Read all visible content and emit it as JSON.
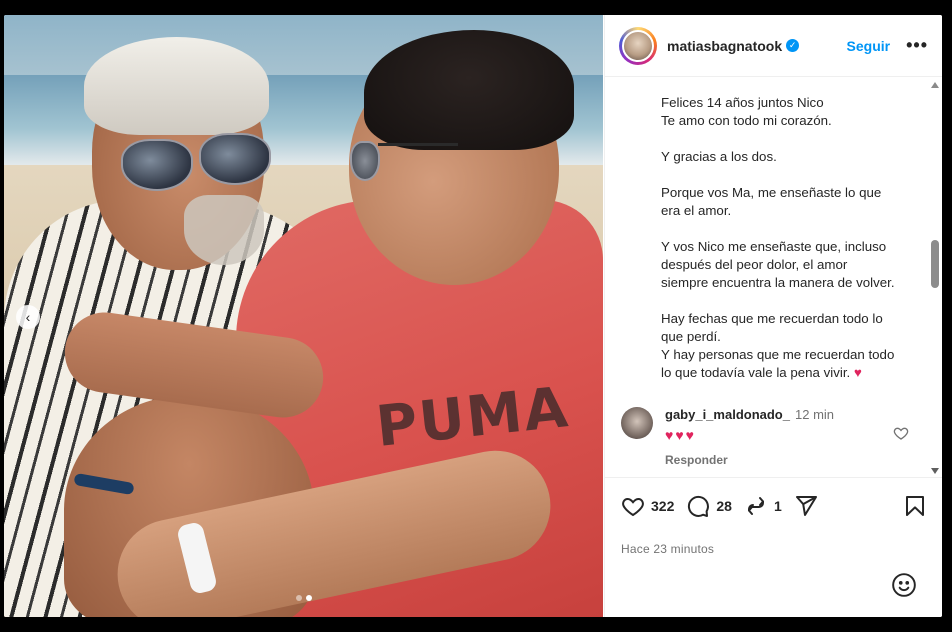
{
  "post": {
    "username": "matiasbagnatook",
    "verified_mark": "✓",
    "follow_label": "Seguir",
    "more_label": "•••",
    "caption": "Felices 14 años juntos Nico\nTe amo con todo mi corazón.\n\nY gracias a los dos.\n\nPorque vos Ma, me enseñaste lo que\nera el amor.\n\nY vos Nico me enseñaste que, incluso\ndespués del peor dolor, el amor\nsiempre encuentra la manera de volver.\n\nHay fechas que me recuerdan todo lo\nque perdí.\nY hay personas que me recuerdan todo\nlo que todavía vale la pena vivir.",
    "caption_emoji": "♥",
    "photo_text": "PUMA",
    "carousel": {
      "total": 2,
      "active_index": 2
    }
  },
  "comment": {
    "username": "gaby_i_maldonado_",
    "time": "12 min",
    "text": "♥♥♥",
    "reply_label": "Responder"
  },
  "actions": {
    "likes": "322",
    "comments": "28",
    "reposts": "1",
    "time_ago": "Hace 23 minutos"
  },
  "colors": {
    "accent": "#0095f6",
    "heart": "#e0245e",
    "muted": "#737373"
  },
  "icons": {
    "prev": "chevron-left-icon",
    "like": "heart-icon",
    "comment": "comment-icon",
    "repost": "repost-icon",
    "share": "send-icon",
    "save": "bookmark-icon",
    "emoji": "emoji-icon"
  }
}
